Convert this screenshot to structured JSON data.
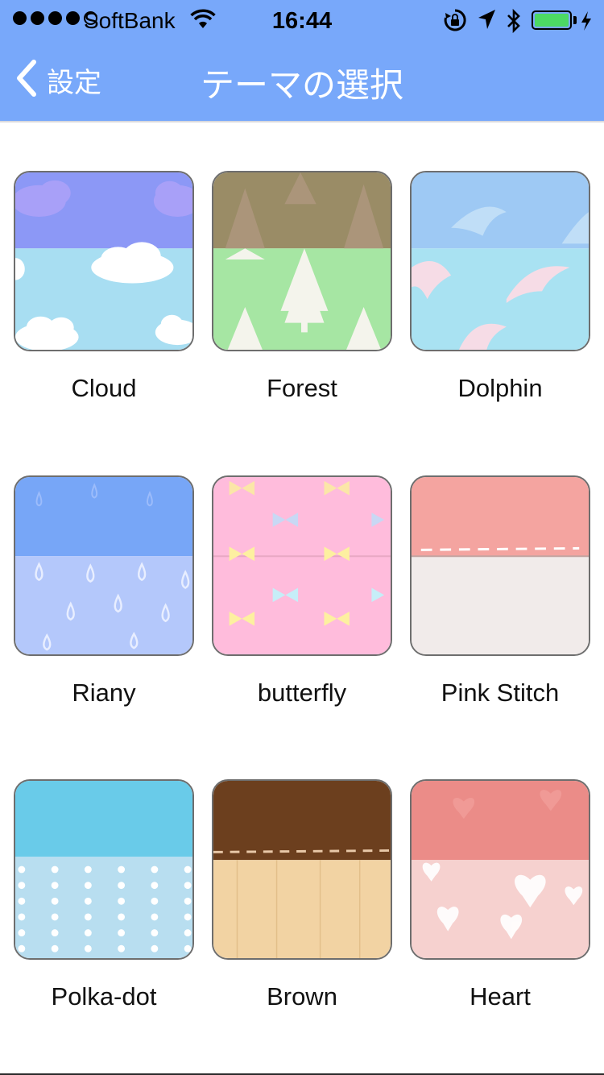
{
  "status_bar": {
    "carrier": "SoftBank",
    "time": "16:44",
    "signal_dots": 5,
    "signal_filled": 4,
    "battery_level": 1.0,
    "icons": [
      "wifi-icon",
      "orientation-lock-icon",
      "location-arrow-icon",
      "bluetooth-icon",
      "battery-icon",
      "charging-bolt-icon"
    ]
  },
  "nav": {
    "back_label": "設定",
    "title": "テーマの選択"
  },
  "colors": {
    "header": "#78a8fa",
    "battery": "#4cd964"
  },
  "themes": [
    {
      "id": "cloud",
      "label": "Cloud",
      "top": "#8c98f6",
      "bottom": "#a8def2"
    },
    {
      "id": "forest",
      "label": "Forest",
      "top": "#9a8c66",
      "bottom": "#a6e6a3"
    },
    {
      "id": "dolphin",
      "label": "Dolphin",
      "top": "#9ec9f4",
      "bottom": "#a9e2f2"
    },
    {
      "id": "riany",
      "label": "Riany",
      "top": "#77a6f7",
      "bottom": "#b4c8fb"
    },
    {
      "id": "butterfly",
      "label": "butterfly",
      "top": "#ffbcdc",
      "bottom": "#ffbcdc"
    },
    {
      "id": "pink-stitch",
      "label": "Pink Stitch",
      "top": "#f4a4a0",
      "bottom": "#f1ebea"
    },
    {
      "id": "polka-dot",
      "label": "Polka-dot",
      "top": "#69cbe9",
      "bottom": "#b8def0"
    },
    {
      "id": "brown",
      "label": "Brown",
      "top": "#6c3f1e",
      "bottom": "#f2d3a3"
    },
    {
      "id": "heart",
      "label": "Heart",
      "top": "#eb8c88",
      "bottom": "#f6d1cf"
    }
  ]
}
